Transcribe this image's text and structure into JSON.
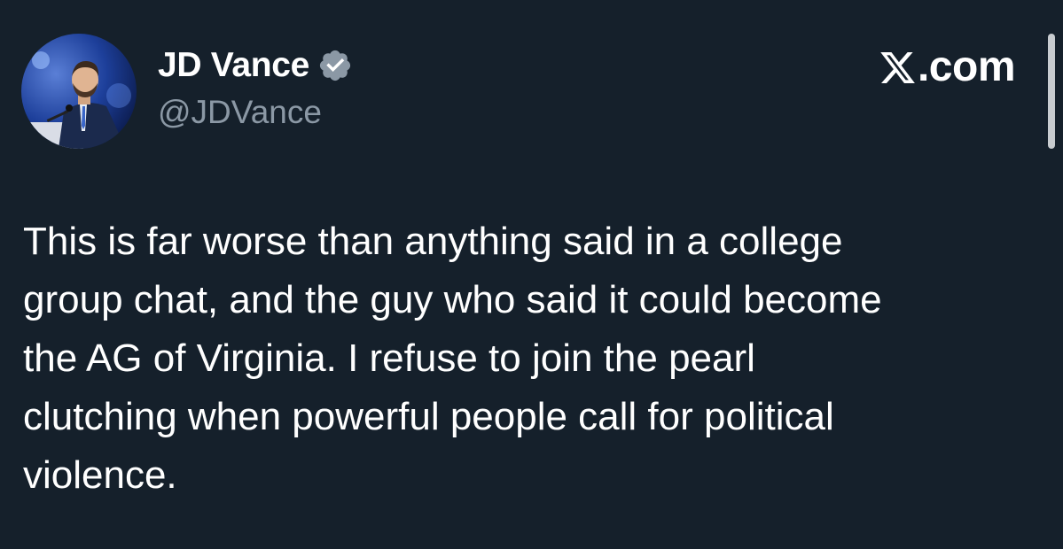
{
  "author": {
    "display_name": "JD Vance",
    "handle": "@JDVance",
    "verified": true,
    "verified_color": "#8b98a5",
    "avatar_icon": "profile-photo"
  },
  "site": {
    "logo_icon": "x-logo-icon",
    "suffix": ".com"
  },
  "tweet": {
    "text": "This is far worse than anything said in a college\ngroup chat, and the guy who said it could become\nthe AG of Virginia. I refuse to join the pearl\nclutching when powerful people call for political\nviolence."
  },
  "colors": {
    "background": "#15202b",
    "text": "#ffffff",
    "secondary_text": "#8b98a5"
  }
}
